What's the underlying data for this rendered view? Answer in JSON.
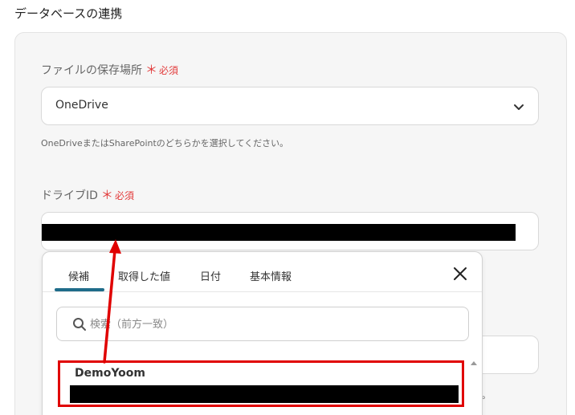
{
  "section": {
    "title": "データベースの連携"
  },
  "storage": {
    "label": "ファイルの保存場所",
    "required_mark": "＊",
    "required_text": "必須",
    "value": "OneDrive",
    "help": "OneDriveまたはSharePointのどちらかを選択してください。"
  },
  "drive": {
    "label": "ドライブID",
    "required_mark": "＊",
    "required_text": "必須"
  },
  "background": {
    "trailing_text": "。"
  },
  "dropdown": {
    "tabs": [
      "候補",
      "取得した値",
      "日付",
      "基本情報"
    ],
    "active_tab": "候補",
    "search_placeholder": "検索（前方一致）",
    "options": [
      {
        "name": "DemoYoom"
      }
    ]
  },
  "colors": {
    "accent": "#1f6c8a",
    "required": "#e23b3b",
    "annotation": "#e00000"
  }
}
